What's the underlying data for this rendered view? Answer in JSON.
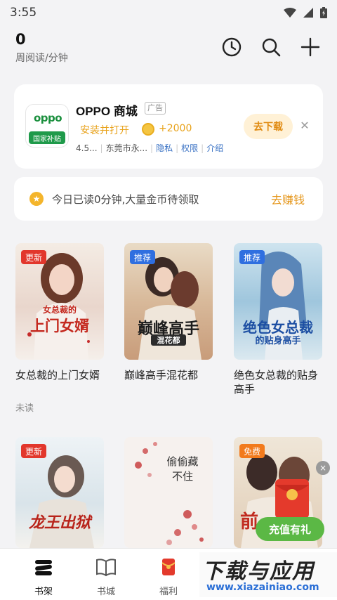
{
  "status": {
    "time": "3:55"
  },
  "header": {
    "read_count": "0",
    "read_unit": "周阅读/分钟"
  },
  "ad": {
    "title": "OPPO 商城",
    "tag": "广告",
    "logo_text": "oppo",
    "logo_sub": "国家补贴",
    "action": "安装并打开",
    "coins": "+2000",
    "rating": "4.5...",
    "company": "东莞市永...",
    "privacy": "隐私",
    "permission": "权限",
    "intro": "介绍",
    "download": "去下载"
  },
  "earn": {
    "text": "今日已读0分钟,大量金币待领取",
    "button": "去赚钱"
  },
  "books": [
    {
      "title": "女总裁的上门女婿",
      "badge": "更新",
      "status": "未读",
      "cover_text": "上门女婿",
      "cover_top": "女总裁的"
    },
    {
      "title": "巅峰高手混花都",
      "badge": "推荐",
      "status": "",
      "cover_text": "巅峰高手",
      "cover_top": "混花都"
    },
    {
      "title": "绝色女总裁的贴身高手",
      "badge": "推荐",
      "status": "",
      "cover_text": "绝色女总裁",
      "cover_top": "的贴身高手"
    },
    {
      "title": "",
      "badge": "更新",
      "status": "",
      "cover_text": "龙王出狱",
      "cover_top": ""
    },
    {
      "title": "",
      "badge": "",
      "status": "",
      "cover_text": "偷偷藏不住",
      "cover_top": ""
    },
    {
      "title": "",
      "badge": "免费",
      "status": "",
      "cover_text": "前",
      "cover_top": ""
    }
  ],
  "promo": {
    "label": "充值有礼",
    "close": "×"
  },
  "nav": {
    "items": [
      "书架",
      "书城",
      "福利"
    ]
  },
  "watermark": {
    "main": "下载与应用",
    "sub": "www.xiazainiao.com"
  }
}
